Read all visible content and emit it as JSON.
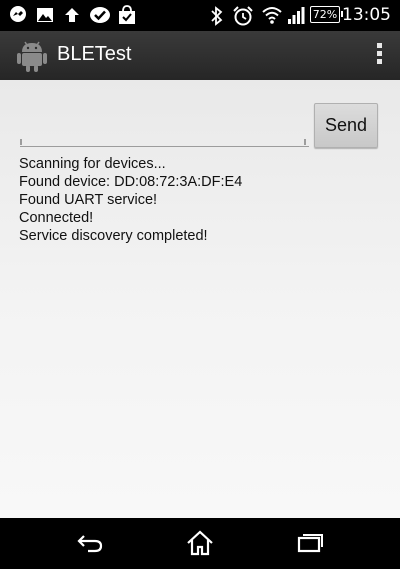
{
  "status_bar": {
    "time": "13:05",
    "battery": "72%",
    "left_icons": [
      "messenger-icon",
      "gallery-icon",
      "upload-icon",
      "check-icon",
      "shop-bag-icon"
    ],
    "right_icons": [
      "bluetooth-icon",
      "alarm-icon",
      "wifi-icon",
      "signal-icon",
      "battery-icon"
    ]
  },
  "action_bar": {
    "title": "BLETest",
    "app_icon": "android-robot-icon",
    "menu_icon": "overflow-menu-icon",
    "background": "#2f2f2f"
  },
  "composer": {
    "input_value": "",
    "send_label": "Send"
  },
  "log": [
    "Scanning for devices...",
    "Found device: DD:08:72:3A:DF:E4",
    "Found UART service!",
    "Connected!",
    "Service discovery completed!"
  ],
  "nav_bar": {
    "back_icon": "back-icon",
    "home_icon": "home-icon",
    "recents_icon": "recents-icon"
  }
}
